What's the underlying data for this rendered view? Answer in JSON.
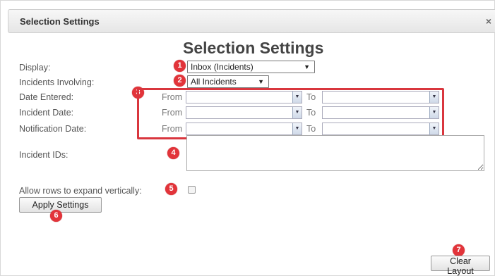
{
  "dialog": {
    "title": "Selection Settings",
    "close_glyph": "×",
    "heading": "Selection Settings"
  },
  "fields": {
    "display_label": "Display:",
    "display_value": "Inbox (Incidents)",
    "involving_label": "Incidents Involving:",
    "involving_value": "All Incidents",
    "date_entered_label": "Date Entered:",
    "incident_date_label": "Incident Date:",
    "notification_date_label": "Notification Date:",
    "from_label": "From",
    "to_label": "To",
    "incident_ids_label": "Incident IDs:",
    "incident_ids_value": "",
    "expand_rows_label": "Allow rows to expand vertically:",
    "expand_rows_checked": false
  },
  "buttons": {
    "apply": "Apply Settings",
    "clear": "Clear Layout"
  },
  "badges": [
    "1",
    "2",
    "3",
    "4",
    "5",
    "6",
    "7"
  ],
  "icons": {
    "select_arrow": "▼",
    "date_dropdown": "▼"
  },
  "colors": {
    "badge": "#e2343a",
    "highlight_box": "#d9363e"
  }
}
